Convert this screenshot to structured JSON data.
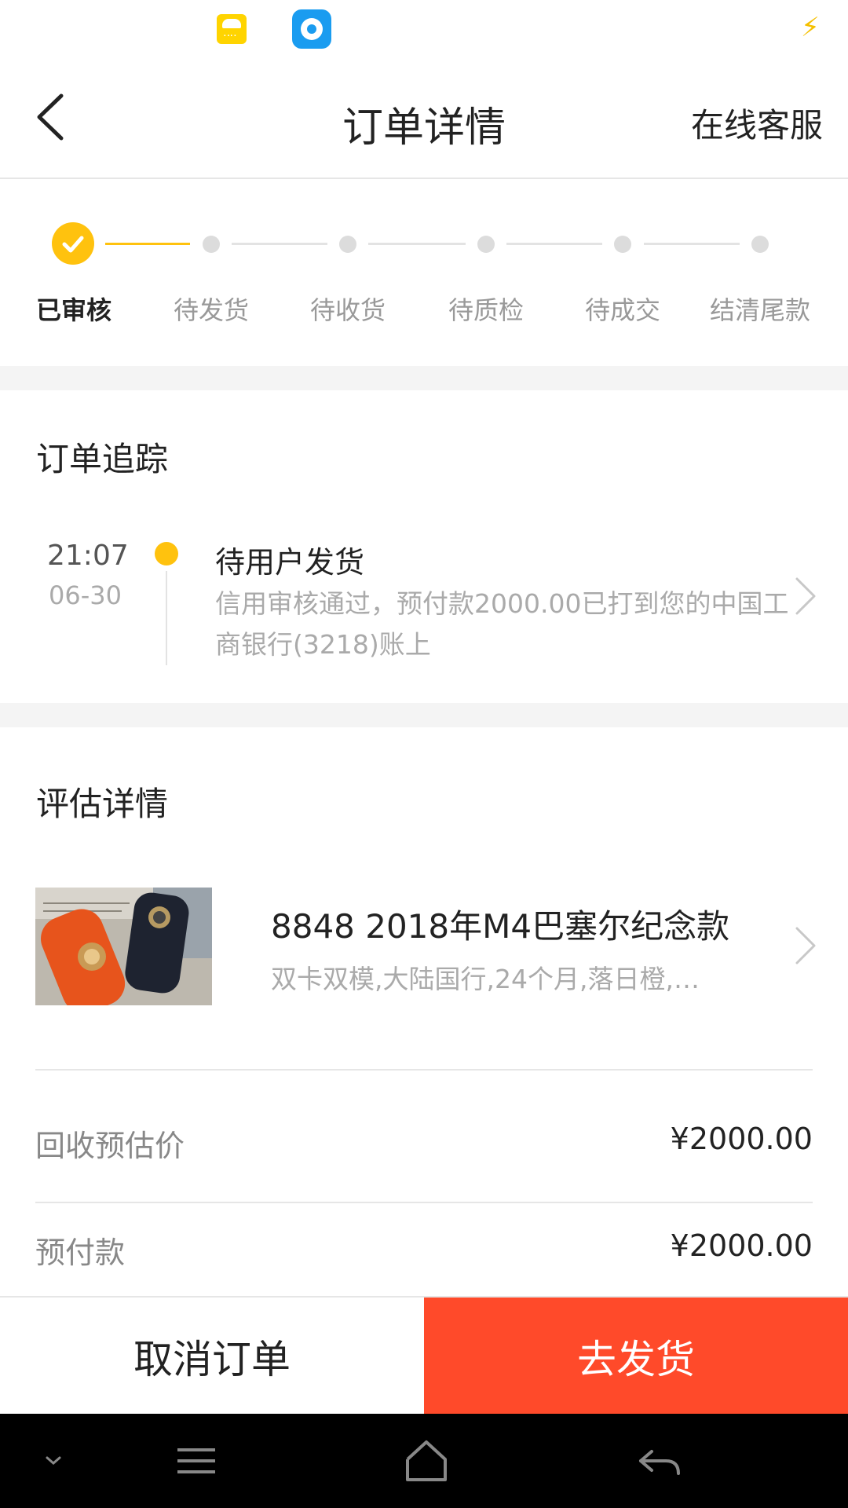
{
  "status_bar": {
    "icons": [
      "rain-weather-icon",
      "app-notification-icon",
      "charging-icon"
    ],
    "charge_symbol": "⚡"
  },
  "nav": {
    "title": "订单详情",
    "service_label": "在线客服"
  },
  "progress": {
    "current_step": 0,
    "steps": [
      "已审核",
      "待发货",
      "待收货",
      "待质检",
      "待成交",
      "结清尾款"
    ]
  },
  "tracking": {
    "title": "订单追踪",
    "entry": {
      "time": "21:07",
      "date": "06-30",
      "status": "待用户发货",
      "description": "信用审核通过，预付款2000.00已打到您的中国工商银行(3218)账上"
    }
  },
  "evaluation": {
    "title": "评估详情",
    "product": {
      "name": "8848 2018年M4巴塞尔纪念款",
      "spec": "双卡双模,大陆国行,24个月,落日橙,…"
    },
    "rows": [
      {
        "label": "回收预估价",
        "value": "¥2000.00"
      },
      {
        "label": "预付款",
        "value": "¥2000.00"
      }
    ]
  },
  "actions": {
    "cancel_label": "取消订单",
    "ship_label": "去发货"
  },
  "colors": {
    "accent": "#ffc20e",
    "primary_button": "#ff4a2a",
    "muted_text": "#aaaaaa"
  }
}
